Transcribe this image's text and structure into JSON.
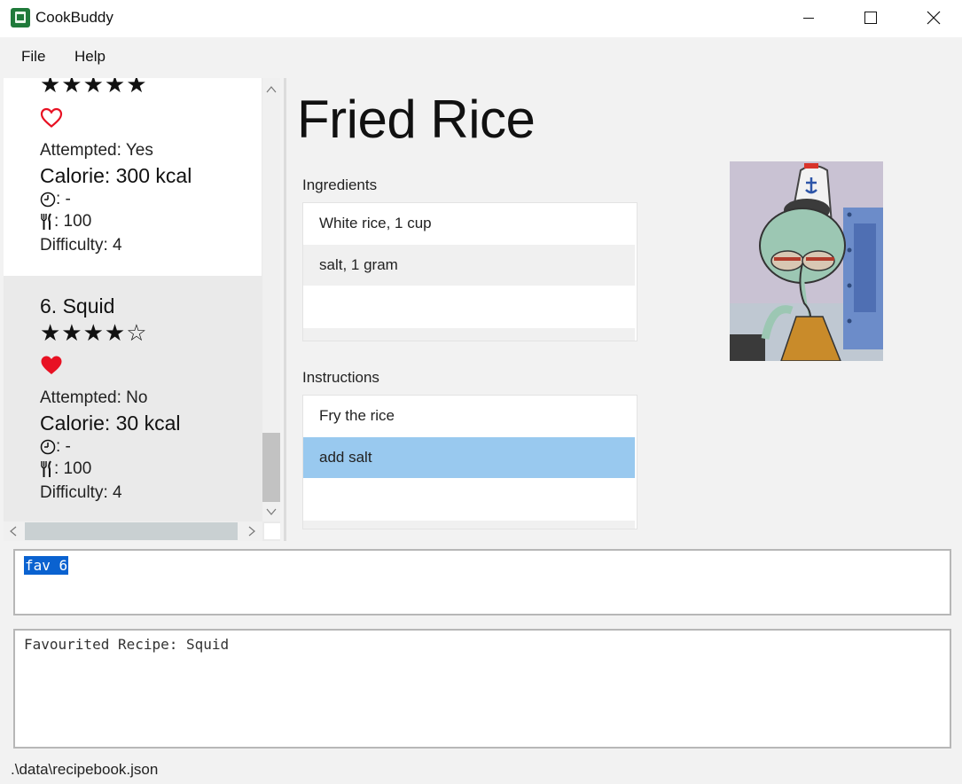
{
  "window": {
    "title": "CookBuddy",
    "minimize_icon": "minimize-icon",
    "maximize_icon": "maximize-icon",
    "close_icon": "close-icon"
  },
  "menu": {
    "file": "File",
    "help": "Help"
  },
  "recipe_list": {
    "cards": [
      {
        "stars": "★★★★★",
        "favourite": false,
        "attempted": "Attempted: Yes",
        "calorie": "Calorie: 300 kcal",
        "time": ": -",
        "serving": ": 100",
        "difficulty": "Difficulty: 4"
      },
      {
        "title": "6.  Squid",
        "stars": "★★★★☆",
        "favourite": true,
        "attempted": "Attempted: No",
        "calorie": "Calorie: 30 kcal",
        "time": ": -",
        "serving": ": 100",
        "difficulty": "Difficulty: 4"
      }
    ]
  },
  "detail": {
    "title": "Fried Rice",
    "ingredients_label": "Ingredients",
    "ingredients": [
      "White rice, 1 cup",
      "salt, 1 gram"
    ],
    "instructions_label": "Instructions",
    "instructions": [
      "Fry the rice",
      "add salt"
    ],
    "selected_instruction_index": 1
  },
  "command": {
    "text": "fav 6"
  },
  "result": {
    "text": "Favourited Recipe: Squid"
  },
  "status": {
    "path": ".\\data\\recipebook.json"
  },
  "colors": {
    "heart": "#e81123",
    "selection": "#99c9ef",
    "command_highlight": "#0a62d0",
    "app_icon": "#1f7a3a"
  }
}
